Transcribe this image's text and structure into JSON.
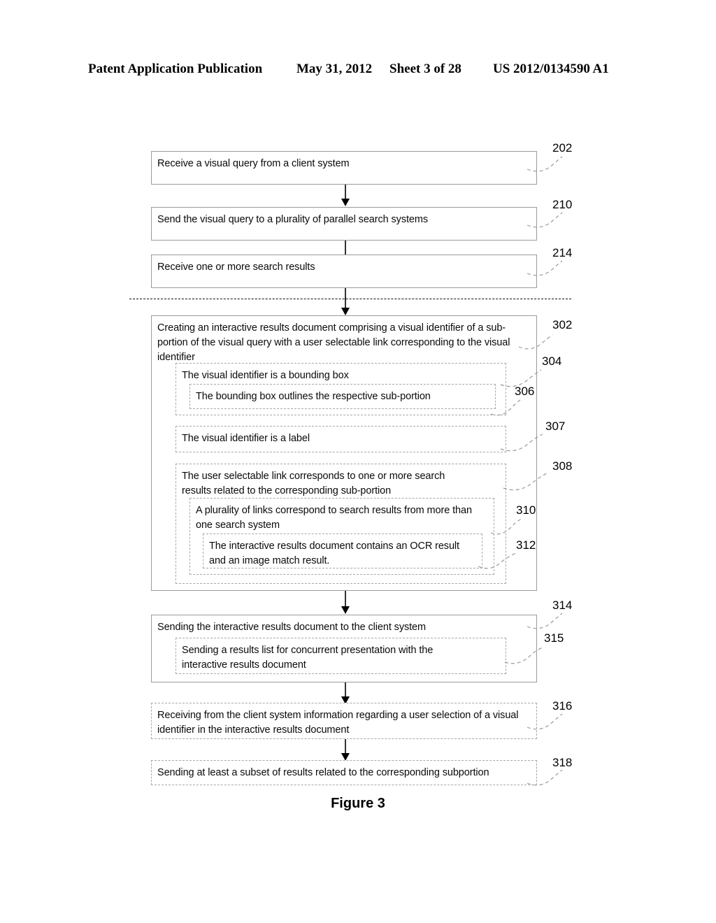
{
  "header": {
    "publication": "Patent Application Publication",
    "date": "May 31, 2012",
    "sheet": "Sheet 3 of 28",
    "document_number": "US 2012/0134590 A1"
  },
  "figure": {
    "caption": "Figure 3",
    "divider_style": "dashed-horizontal-separator"
  },
  "steps": [
    {
      "ref": "202",
      "text": "Receive a visual query from a client system"
    },
    {
      "ref": "210",
      "text": "Send the visual query to a plurality of parallel search systems"
    },
    {
      "ref": "214",
      "text": "Receive one or more search results"
    },
    {
      "ref": "302",
      "text": "Creating an interactive results document comprising a visual identifier of a sub-portion of the visual query with a user selectable link corresponding to the visual identifier"
    },
    {
      "ref": "304",
      "text": "The visual identifier is a bounding box"
    },
    {
      "ref": "306",
      "text": "The bounding box outlines the respective sub-portion"
    },
    {
      "ref": "307",
      "text": "The visual identifier is a label"
    },
    {
      "ref": "308",
      "text": "The user selectable link corresponds to one or more search results related to the corresponding sub-portion"
    },
    {
      "ref": "310",
      "text": "A plurality of links correspond to search results from more than one search system"
    },
    {
      "ref": "312",
      "text": "The interactive results document contains an OCR result and an image match result."
    },
    {
      "ref": "314",
      "text": "Sending the interactive results document to the client system"
    },
    {
      "ref": "315",
      "text": "Sending a results list for concurrent presentation with the interactive results document"
    },
    {
      "ref": "316",
      "text": "Receiving from the client system information regarding a user selection of a visual identifier in the interactive results document"
    },
    {
      "ref": "318",
      "text": "Sending at least a subset of results related to the corresponding subportion"
    }
  ]
}
